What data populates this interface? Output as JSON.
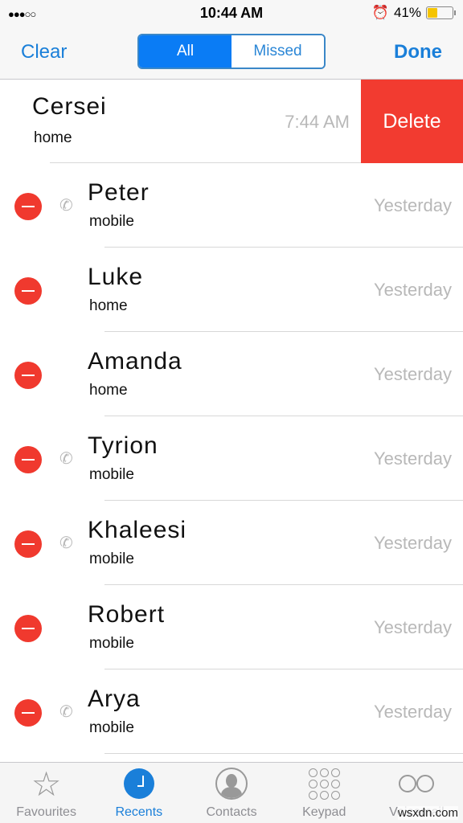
{
  "status": {
    "signal": "●●●○○",
    "time": "10:44 AM",
    "battery": "41%",
    "battery_level": 0.41,
    "alarm_icon": "alarm-icon"
  },
  "nav": {
    "clear": "Clear",
    "segments": [
      "All",
      "Missed"
    ],
    "selected": "All",
    "done": "Done"
  },
  "swiped": {
    "name": "Cersei",
    "type": "home",
    "time": "7:44 AM",
    "delete_label": "Delete"
  },
  "calls": [
    {
      "name": "Peter",
      "type": "mobile",
      "date": "Yesterday",
      "outgoing": true
    },
    {
      "name": "Luke",
      "type": "home",
      "date": "Yesterday",
      "outgoing": false
    },
    {
      "name": "Amanda",
      "type": "home",
      "date": "Yesterday",
      "outgoing": false
    },
    {
      "name": "Tyrion",
      "type": "mobile",
      "date": "Yesterday",
      "outgoing": true
    },
    {
      "name": "Khaleesi",
      "type": "mobile",
      "date": "Yesterday",
      "outgoing": true
    },
    {
      "name": "Robert",
      "type": "mobile",
      "date": "Yesterday",
      "outgoing": false
    },
    {
      "name": "Arya",
      "type": "mobile",
      "date": "Yesterday",
      "outgoing": true
    }
  ],
  "tabs": [
    {
      "label": "Favourites"
    },
    {
      "label": "Recents"
    },
    {
      "label": "Contacts"
    },
    {
      "label": "Keypad"
    },
    {
      "label": "Voicemail"
    }
  ],
  "active_tab": "Recents",
  "colors": {
    "accent": "#1a7fd9",
    "delete": "#f23b30"
  },
  "watermark": "wsxdn.com"
}
